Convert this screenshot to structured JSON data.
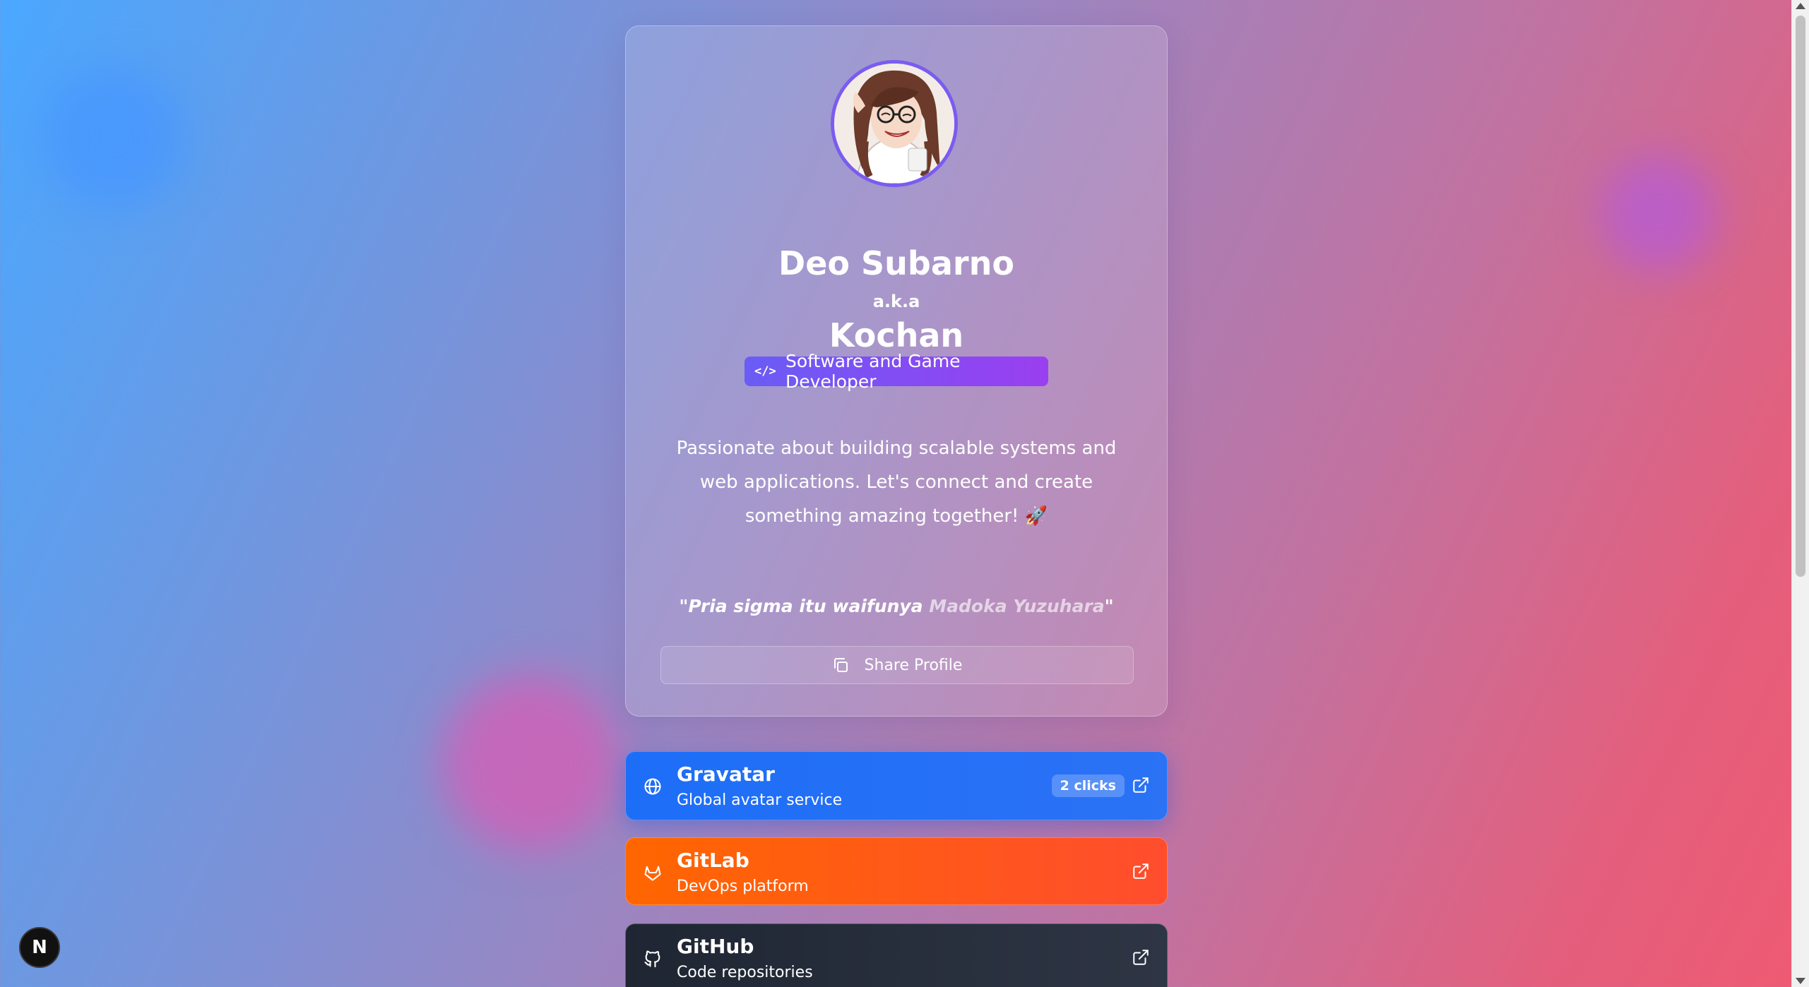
{
  "profile": {
    "name": "Deo Subarno",
    "aka": "a.k.a",
    "alias": "Kochan",
    "role": "Software and Game Developer",
    "role_icon": "code-icon",
    "bio": "Passionate about building scalable systems and web applications. Let's connect and create something amazing together! 🚀",
    "quote_prefix": "\"Pria sigma itu waifunya ",
    "quote_highlight": "Madoka Yuzuhara",
    "quote_suffix": "\"",
    "share_label": "Share Profile"
  },
  "links": [
    {
      "title": "Gravatar",
      "subtitle": "Global avatar service",
      "clicks": "2 clicks",
      "icon": "globe-icon",
      "color": "#1d6ef7"
    },
    {
      "title": "GitLab",
      "subtitle": "DevOps platform",
      "icon": "gitlab-icon",
      "color": "#ff5a10"
    },
    {
      "title": "GitHub",
      "subtitle": "Code repositories",
      "icon": "github-icon",
      "color": "#242b38"
    }
  ],
  "dev_badge": {
    "letter": "N"
  },
  "colors": {
    "accent": "#7a5cf0",
    "role_badge_start": "#6a5cf5",
    "role_badge_end": "#9a3ff0"
  }
}
